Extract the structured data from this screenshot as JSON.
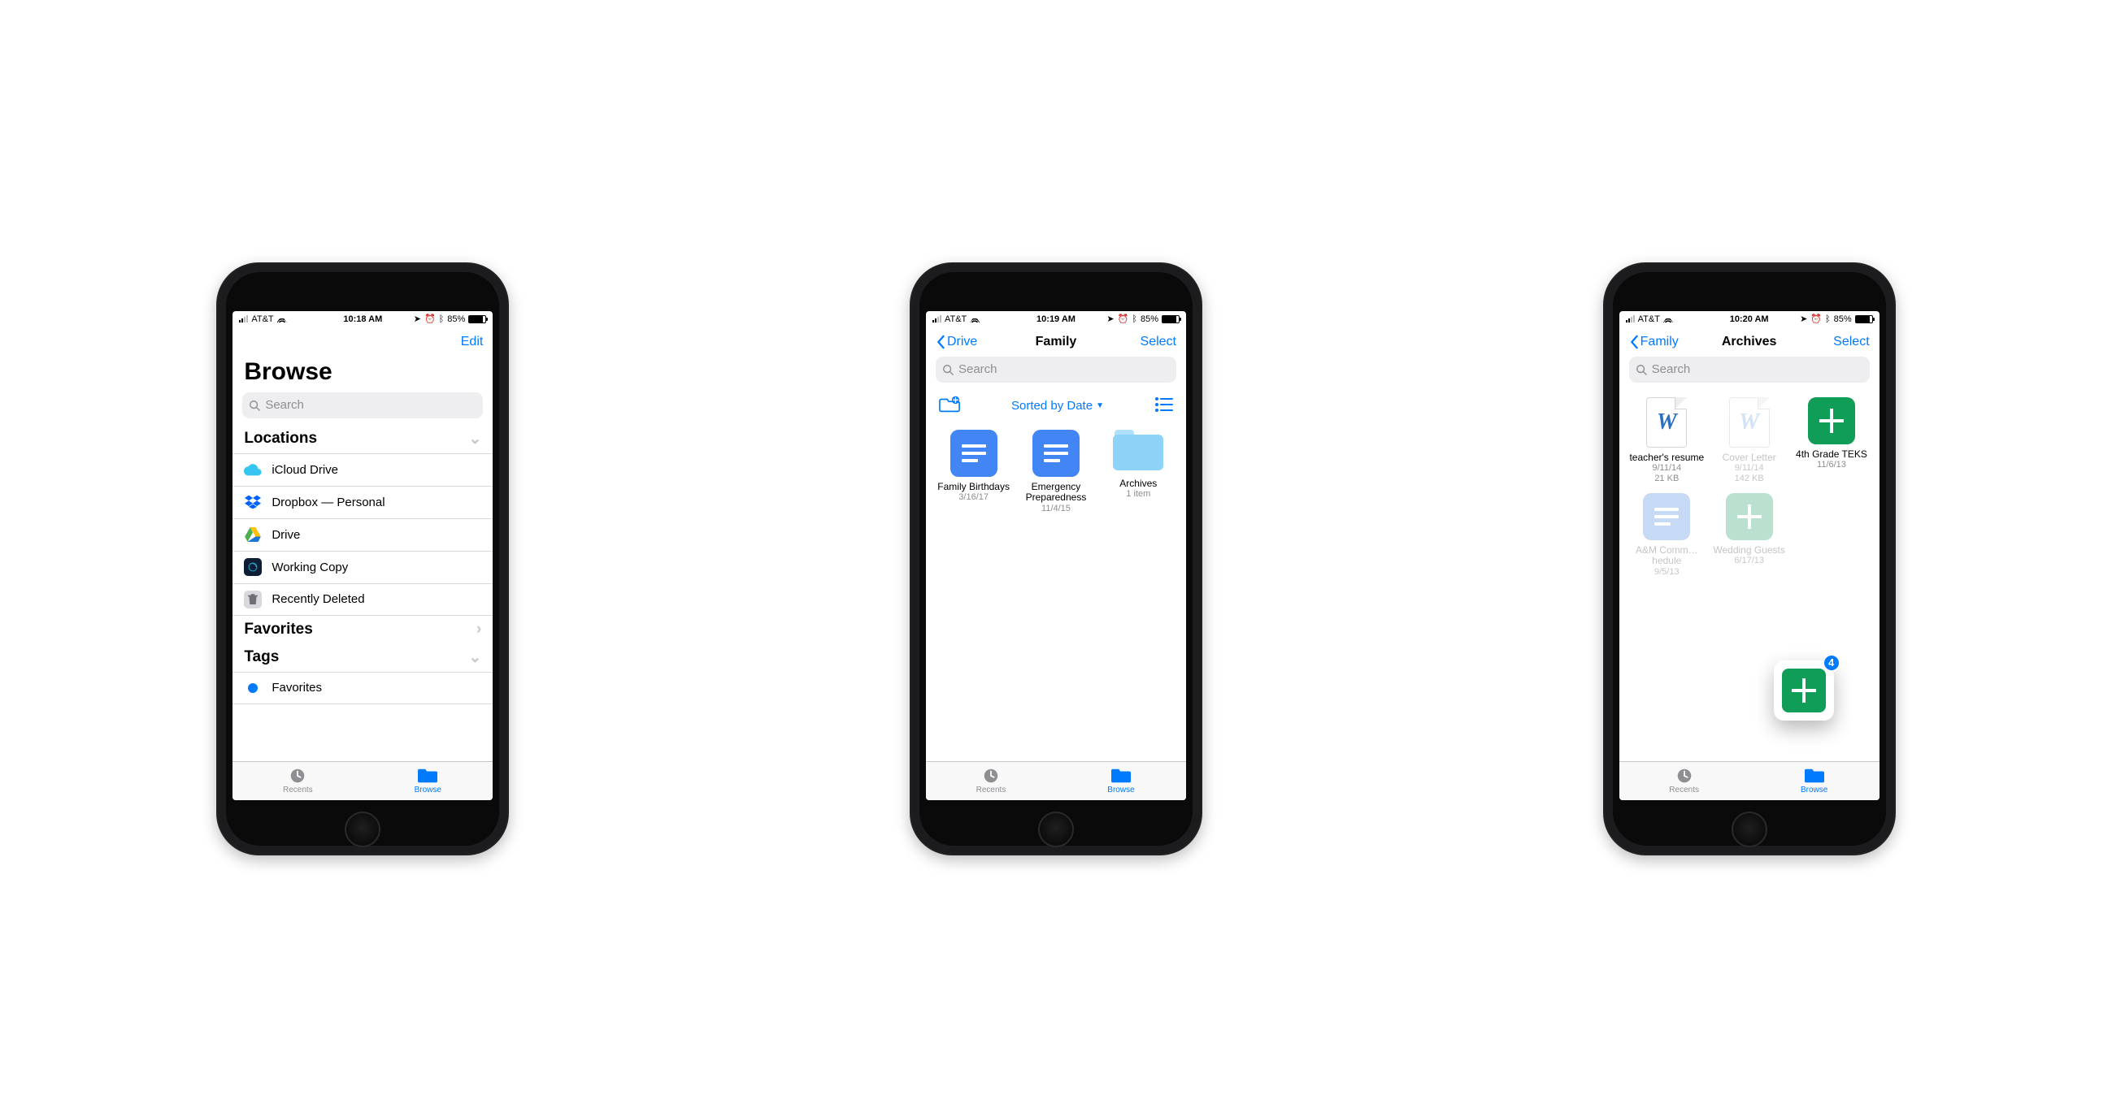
{
  "statusbar": {
    "carrier": "AT&T",
    "times": [
      "10:18 AM",
      "10:19 AM",
      "10:20 AM"
    ],
    "battery_pct": "85%"
  },
  "tabs": {
    "recents": "Recents",
    "browse": "Browse"
  },
  "phone1": {
    "edit": "Edit",
    "title": "Browse",
    "search_placeholder": "Search",
    "sections": {
      "locations": "Locations",
      "favorites_section": "Favorites",
      "tags": "Tags"
    },
    "locations": [
      {
        "label": "iCloud Drive"
      },
      {
        "label": "Dropbox — Personal"
      },
      {
        "label": "Drive"
      },
      {
        "label": "Working Copy"
      },
      {
        "label": "Recently Deleted"
      }
    ],
    "tag_favorites": "Favorites"
  },
  "phone2": {
    "back": "Drive",
    "title": "Family",
    "select": "Select",
    "search_placeholder": "Search",
    "sort": "Sorted by Date",
    "files": [
      {
        "name": "Family Birthdays",
        "meta": "3/16/17",
        "kind": "doc"
      },
      {
        "name": "Emergency Preparedness",
        "meta": "11/4/15",
        "kind": "doc"
      },
      {
        "name": "Archives",
        "meta": "1 item",
        "kind": "folder"
      }
    ]
  },
  "phone3": {
    "back": "Family",
    "title": "Archives",
    "select": "Select",
    "search_placeholder": "Search",
    "drag_count": "4",
    "files": [
      {
        "name": "teacher's resume",
        "meta1": "9/11/14",
        "meta2": "21 KB",
        "kind": "word"
      },
      {
        "name": "Cover Letter",
        "meta1": "9/11/14",
        "meta2": "142 KB",
        "kind": "word-light"
      },
      {
        "name": "4th Grade TEKS",
        "meta1": "11/6/13",
        "kind": "sheet"
      },
      {
        "name": "A&M Comm…hedule",
        "meta1": "9/5/13",
        "kind": "doc-light"
      },
      {
        "name": "Wedding Guests",
        "meta1": "6/17/13",
        "kind": "sheet-light"
      }
    ]
  }
}
